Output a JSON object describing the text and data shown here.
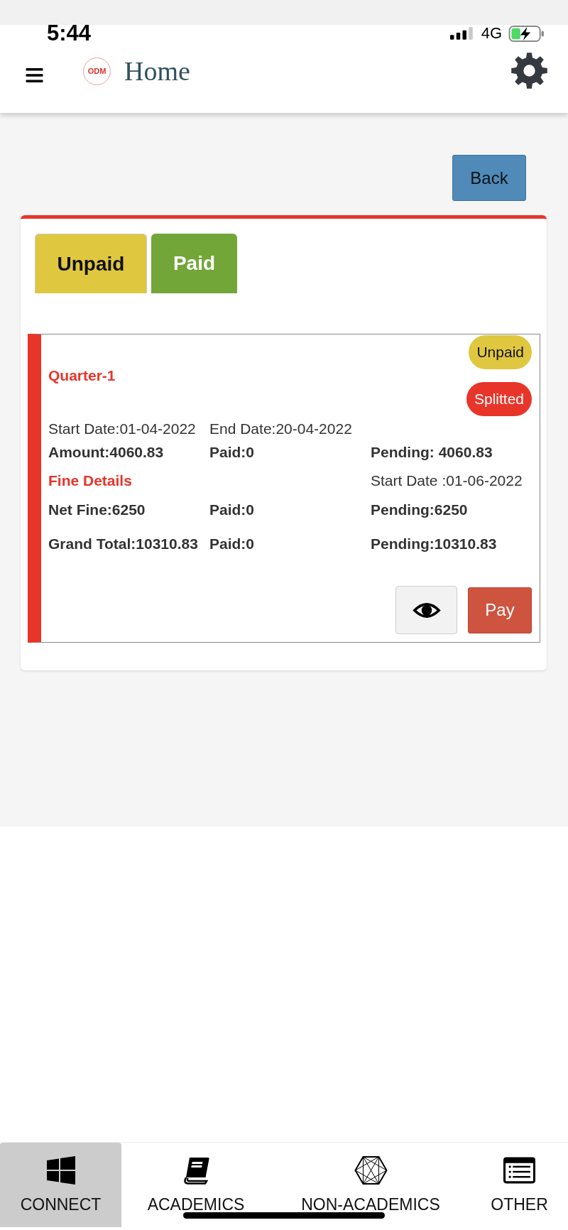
{
  "status_bar": {
    "time": "5:44",
    "network": "4G"
  },
  "header": {
    "logo_text": "ODM",
    "title": "Home"
  },
  "back_button": "Back",
  "tabs": [
    {
      "label": "Unpaid",
      "selected": true,
      "color": "#dfc73f"
    },
    {
      "label": "Paid",
      "selected": false,
      "color": "#72a638"
    }
  ],
  "fee_cards": [
    {
      "title": "Quarter-1",
      "badges": [
        {
          "label": "Unpaid",
          "color": "#dfc73f"
        },
        {
          "label": "Splitted",
          "color": "#e8352a"
        }
      ],
      "dates": [
        "Start Date:01-04-2022",
        "End Date:20-04-2022"
      ],
      "amount_row": [
        "Amount:4060.83",
        "Paid:0",
        "Pending: 4060.83"
      ],
      "fine_heading": "Fine Details",
      "fine_start_date": "Start Date :01-06-2022",
      "fine_row": [
        "Net Fine:6250",
        "Paid:0",
        "Pending:6250"
      ],
      "total_row": [
        "Grand Total:10310.83",
        "Paid:0",
        "Pending:10310.83"
      ],
      "pay_button": "Pay"
    }
  ],
  "bottom_nav": [
    {
      "label": "CONNECT",
      "selected": true
    },
    {
      "label": "ACADEMICS",
      "selected": false
    },
    {
      "label": "NON-ACADEMICS",
      "selected": false
    },
    {
      "label": "OTHER",
      "selected": false
    }
  ]
}
